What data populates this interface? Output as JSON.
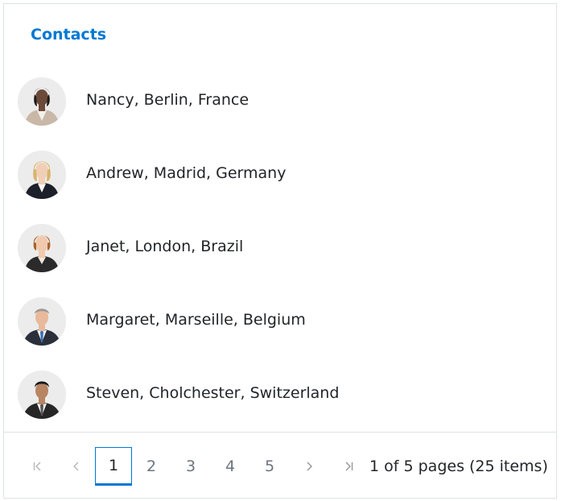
{
  "header": {
    "title": "Contacts"
  },
  "contacts": [
    {
      "label": "Nancy, Berlin, France",
      "avatar": "female-contact-avatar"
    },
    {
      "label": "Andrew, Madrid, Germany",
      "avatar": "female-contact-avatar"
    },
    {
      "label": "Janet, London, Brazil",
      "avatar": "female-contact-avatar"
    },
    {
      "label": "Margaret, Marseille, Belgium",
      "avatar": "male-contact-avatar"
    },
    {
      "label": "Steven, Cholchester, Switzerland",
      "avatar": "male-contact-avatar"
    }
  ],
  "pager": {
    "pages": [
      "1",
      "2",
      "3",
      "4",
      "5"
    ],
    "current_page": "1",
    "info": "1 of 5 pages (25 items)",
    "icons": [
      "first-page-icon",
      "previous-page-icon",
      "next-page-icon",
      "last-page-icon"
    ]
  },
  "colors": {
    "accent": "#0078d4",
    "text": "#212529",
    "muted": "#6c757d",
    "border": "#dee2e6"
  }
}
